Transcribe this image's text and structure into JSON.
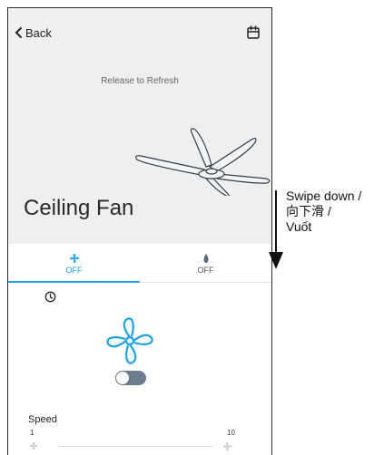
{
  "header": {
    "back_label": "Back",
    "refresh_text": "Release to Refresh",
    "device_title": "Ceiling Fan"
  },
  "tabs": [
    {
      "label": "OFF",
      "icon": "fan-icon",
      "active": true
    },
    {
      "label": "OFF",
      "icon": "light-bulb-icon",
      "active": false
    }
  ],
  "controls": {
    "power_toggle_on": false
  },
  "speed": {
    "label": "Speed",
    "min": "1",
    "max": "10"
  },
  "annotation": {
    "line1": "Swipe down /",
    "line2": "向下滑 /",
    "line3": "Vuốt"
  },
  "colors": {
    "accent": "#1ea1e6",
    "header_bg": "#efefef",
    "toggle_off": "#6b7d8c"
  }
}
